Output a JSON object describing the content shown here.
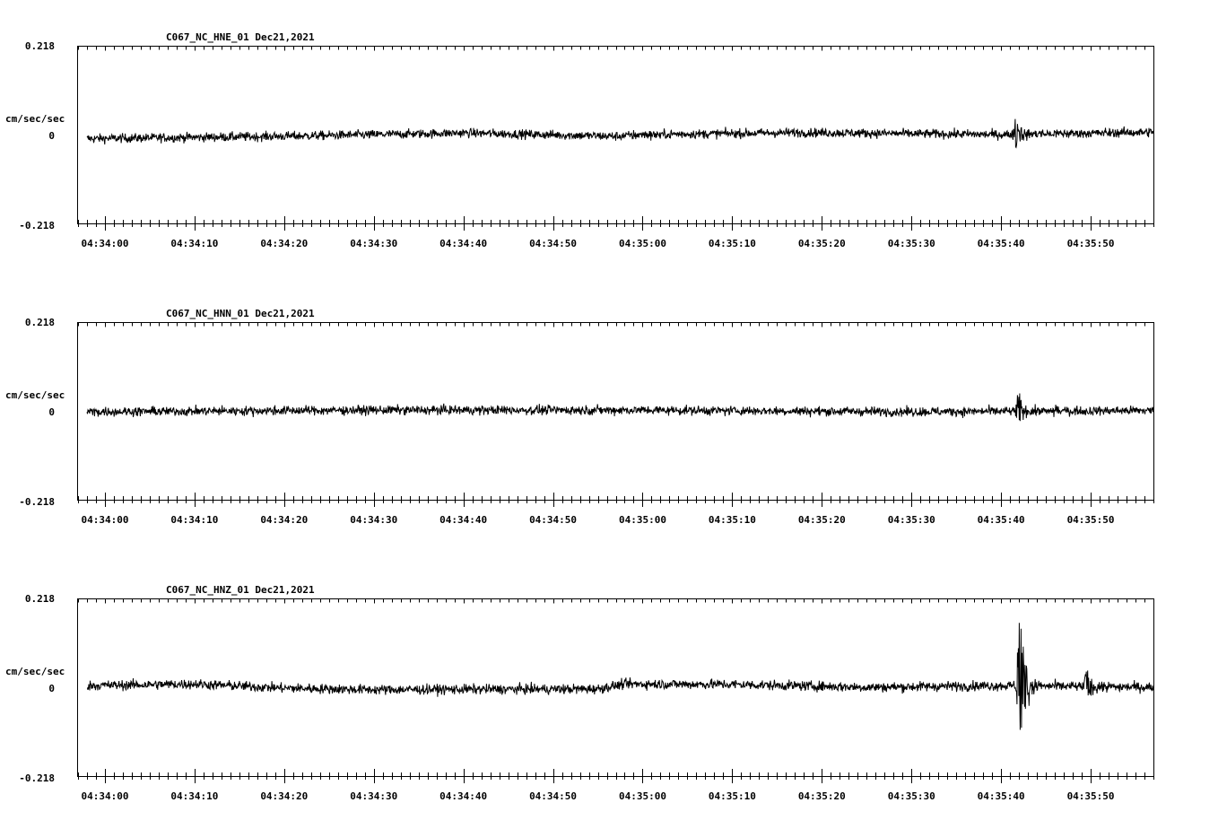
{
  "colors": {
    "background": "#ffffff",
    "trace": "#000000",
    "frame": "#000000"
  },
  "chart_data": [
    {
      "type": "line",
      "title": "C067_NC_HNE_01   Dec21,2021",
      "ylabel": "cm/sec/sec",
      "ylim": [
        -0.218,
        0.218
      ],
      "y_ticks": [
        "0.218",
        "0",
        "-0.218"
      ],
      "x_tick_labels": [
        "04:34:00",
        "04:34:10",
        "04:34:20",
        "04:34:30",
        "04:34:40",
        "04:34:50",
        "04:35:00",
        "04:35:10",
        "04:35:20",
        "04:35:30",
        "04:35:40",
        "04:35:50"
      ],
      "xlim_seconds": [
        -3,
        117
      ],
      "series": [
        {
          "noise_amplitude": 0.012,
          "events": [
            {
              "t": 101.6,
              "amp": 0.045
            },
            {
              "t": 59.0,
              "amp": 0.01
            }
          ],
          "drift": [
            [
              -2,
              -0.01
            ],
            [
              20,
              -0.004
            ],
            [
              40,
              0.004
            ],
            [
              57,
              -0.004
            ],
            [
              60,
              0.0
            ],
            [
              78,
              0.005
            ],
            [
              100,
              0.0
            ],
            [
              117,
              0.006
            ]
          ]
        }
      ]
    },
    {
      "type": "line",
      "title": "C067_NC_HNN_01   Dec21,2021",
      "ylabel": "cm/sec/sec",
      "ylim": [
        -0.218,
        0.218
      ],
      "y_ticks": [
        "0.218",
        "0",
        "-0.218"
      ],
      "x_tick_labels": [
        "04:34:00",
        "04:34:10",
        "04:34:20",
        "04:34:30",
        "04:34:40",
        "04:34:50",
        "04:35:00",
        "04:35:10",
        "04:35:20",
        "04:35:30",
        "04:35:40",
        "04:35:50"
      ],
      "xlim_seconds": [
        -3,
        117
      ],
      "series": [
        {
          "noise_amplitude": 0.012,
          "events": [
            {
              "t": 101.9,
              "amp": 0.045
            },
            {
              "t": 106.0,
              "amp": 0.02
            }
          ],
          "drift": [
            [
              -2,
              -0.002
            ],
            [
              30,
              0.002
            ],
            [
              60,
              0.002
            ],
            [
              90,
              -0.002
            ],
            [
              117,
              0.001
            ]
          ]
        }
      ]
    },
    {
      "type": "line",
      "title": "C067_NC_HNZ_01   Dec21,2021",
      "ylabel": "cm/sec/sec",
      "ylim": [
        -0.218,
        0.218
      ],
      "y_ticks": [
        "0.218",
        "0",
        "-0.218"
      ],
      "x_tick_labels": [
        "04:34:00",
        "04:34:10",
        "04:34:20",
        "04:34:30",
        "04:34:40",
        "04:34:50",
        "04:35:00",
        "04:35:10",
        "04:35:20",
        "04:35:30",
        "04:35:40",
        "04:35:50"
      ],
      "xlim_seconds": [
        -3,
        117
      ],
      "series": [
        {
          "noise_amplitude": 0.013,
          "events": [
            {
              "t": 102.0,
              "amp": 0.2
            },
            {
              "t": 109.5,
              "amp": 0.045
            }
          ],
          "drift": [
            [
              -2,
              0.004
            ],
            [
              10,
              0.008
            ],
            [
              20,
              -0.002
            ],
            [
              30,
              -0.006
            ],
            [
              55,
              -0.004
            ],
            [
              58,
              0.008
            ],
            [
              70,
              0.007
            ],
            [
              85,
              0.0
            ],
            [
              100,
              0.004
            ],
            [
              117,
              0.0
            ]
          ]
        }
      ]
    }
  ]
}
